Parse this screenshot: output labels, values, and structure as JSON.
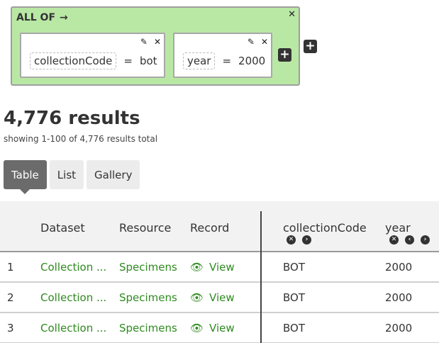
{
  "filter": {
    "group_label": "ALL OF",
    "group_arrow": "→",
    "close_glyph": "✕",
    "terms": [
      {
        "field": "collectionCode",
        "operator": "=",
        "value": "bot"
      },
      {
        "field": "year",
        "operator": "=",
        "value": "2000"
      }
    ],
    "edit_glyph": "✎",
    "add_glyph": "+"
  },
  "results": {
    "count": "4,776 results",
    "summary": "showing 1-100 of 4,776 results total"
  },
  "tabs": [
    "Table",
    "List",
    "Gallery"
  ],
  "active_tab": "Table",
  "table": {
    "headers": [
      "Dataset",
      "Resource",
      "Record",
      "collectionCode",
      "year"
    ],
    "rows": [
      {
        "num": "1",
        "dataset": "Collection ...",
        "resource": "Specimens",
        "record": "View",
        "collectionCode": "BOT",
        "year": "2000"
      },
      {
        "num": "2",
        "dataset": "Collection ...",
        "resource": "Specimens",
        "record": "View",
        "collectionCode": "BOT",
        "year": "2000"
      },
      {
        "num": "3",
        "dataset": "Collection ...",
        "resource": "Specimens",
        "record": "View",
        "collectionCode": "BOT",
        "year": "2000"
      }
    ],
    "ctrl_remove": "✕",
    "ctrl_left": "‹",
    "ctrl_right": "›"
  },
  "colors": {
    "group_bg": "#b9e8a5",
    "link": "#2e8b1e",
    "active_tab": "#6b6b6b"
  }
}
